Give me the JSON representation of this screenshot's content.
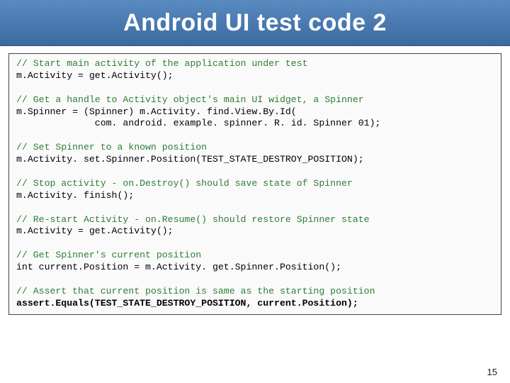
{
  "header": {
    "title": "Android UI test code 2"
  },
  "code": {
    "c1": "// Start main activity of the application under test",
    "l1": "m.Activity = get.Activity();",
    "c2": "// Get a handle to Activity object's main UI widget, a Spinner",
    "l2": "m.Spinner = (Spinner) m.Activity. find.View.By.Id(",
    "l3": "              com. android. example. spinner. R. id. Spinner 01);",
    "c3": "// Set Spinner to a known position",
    "l4": "m.Activity. set.Spinner.Position(TEST_STATE_DESTROY_POSITION);",
    "c4": "// Stop activity - on.Destroy() should save state of Spinner",
    "l5": "m.Activity. finish();",
    "c5": "// Re-start Activity - on.Resume() should restore Spinner state",
    "l6": "m.Activity = get.Activity();",
    "c6": "// Get Spinner's current position",
    "l7": "int current.Position = m.Activity. get.Spinner.Position();",
    "c7": "// Assert that current position is same as the starting position",
    "l8": "assert.Equals(TEST_STATE_DESTROY_POSITION, current.Position);"
  },
  "footer": {
    "page": "15"
  }
}
